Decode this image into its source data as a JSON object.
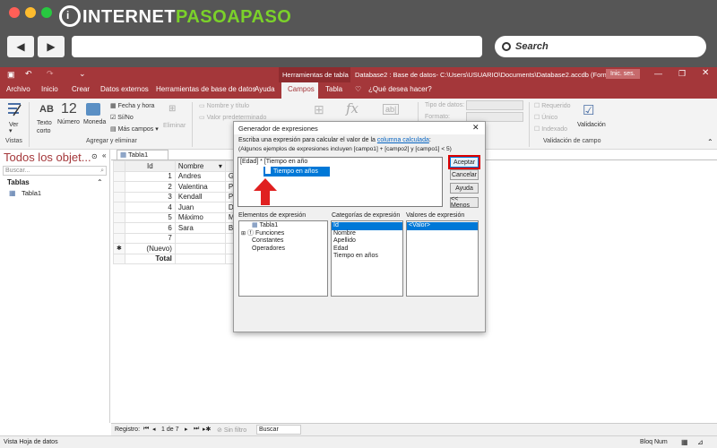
{
  "site": {
    "logo_pre": "INTERNET",
    "logo_post": "PASOAPASO",
    "search_label": "Search",
    "back_icon": "back-arrow-icon",
    "forward_icon": "forward-arrow-icon"
  },
  "titlebar": {
    "tools_label": "Herramientas de tabla",
    "title": "Database2 : Base de datos- C:\\Users\\USUARIO\\Documents\\Database2.accdb (Formato...",
    "signin": "Inic. ses."
  },
  "tabs": [
    "Archivo",
    "Inicio",
    "Crear",
    "Datos externos",
    "Herramientas de base de datos",
    "Ayuda",
    "Campos",
    "Tabla"
  ],
  "tell_me": "¿Qué desea hacer?",
  "ribbon": {
    "ver": "Ver",
    "vistas": "Vistas",
    "texto_corto": "Texto corto",
    "numero": "Número",
    "moneda": "Moneda",
    "fecha_hora": "Fecha y hora",
    "si_no": "Sí/No",
    "mas_campos": "Más campos",
    "eliminar": "Eliminar",
    "agregar_eliminar": "Agregar y eliminar",
    "nombre_titulo": "Nombre y título",
    "valor_pred": "Valor predeterminado",
    "tipo_datos": "Tipo de datos:",
    "formato": "Formato:",
    "requerido": "Requerido",
    "unico": "Único",
    "indexado": "Indexado",
    "validacion": "Validación",
    "validacion_grp": "Validación de campo"
  },
  "nav": {
    "title": "Todos los objet...",
    "search_placeholder": "Buscar...",
    "section": "Tablas",
    "item": "Tabla1"
  },
  "grid": {
    "tab": "Tabla1",
    "headers": [
      "Id",
      "Nombre"
    ],
    "rows": [
      {
        "id": "1",
        "name": "Andres",
        "partial": "Go"
      },
      {
        "id": "2",
        "name": "Valentina",
        "partial": "Pu"
      },
      {
        "id": "3",
        "name": "Kendall",
        "partial": "Pe"
      },
      {
        "id": "4",
        "name": "Juan",
        "partial": "Do"
      },
      {
        "id": "5",
        "name": "Máximo",
        "partial": "Mo"
      },
      {
        "id": "6",
        "name": "Sara",
        "partial": "Bo"
      },
      {
        "id": "7",
        "name": "",
        "partial": ""
      }
    ],
    "new_label": "(Nuevo)",
    "total_label": "Total"
  },
  "dialog": {
    "title": "Generador de expresiones",
    "instr_pre": "Escriba una expresión para calcular el valor de la ",
    "instr_link": "columna calculada",
    "instr_post": ":",
    "examples": "(Algunos ejemplos de expresiones incluyen [campo1] + [campo2] y [campo1] < 5)",
    "expression": "[Edad] * [Tiempo en año",
    "autocomplete": "Tiempo en años",
    "buttons": {
      "ok": "Aceptar",
      "cancel": "Cancelar",
      "help": "Ayuda",
      "less": "<< Menos"
    },
    "col1_title": "Elementos de expresión",
    "col1_items": [
      "Tabla1",
      "Funciones",
      "Constantes",
      "Operadores"
    ],
    "col2_title": "Categorías de expresión",
    "col2_items": [
      "Id",
      "Nombre",
      "Apellido",
      "Edad",
      "Tiempo en años"
    ],
    "col3_title": "Valores de expresión",
    "col3_items": [
      "<Valor>"
    ]
  },
  "records": {
    "label": "Registro:",
    "current": "1 de 7",
    "filter": "Sin filtro",
    "search": "Buscar"
  },
  "status": {
    "left": "Vista Hoja de datos",
    "right": "Bloq Num"
  },
  "colors": {
    "access_red": "#a4373a",
    "chrome": "#565656",
    "highlight": "#0078d7",
    "arrow_red": "#e02020"
  }
}
